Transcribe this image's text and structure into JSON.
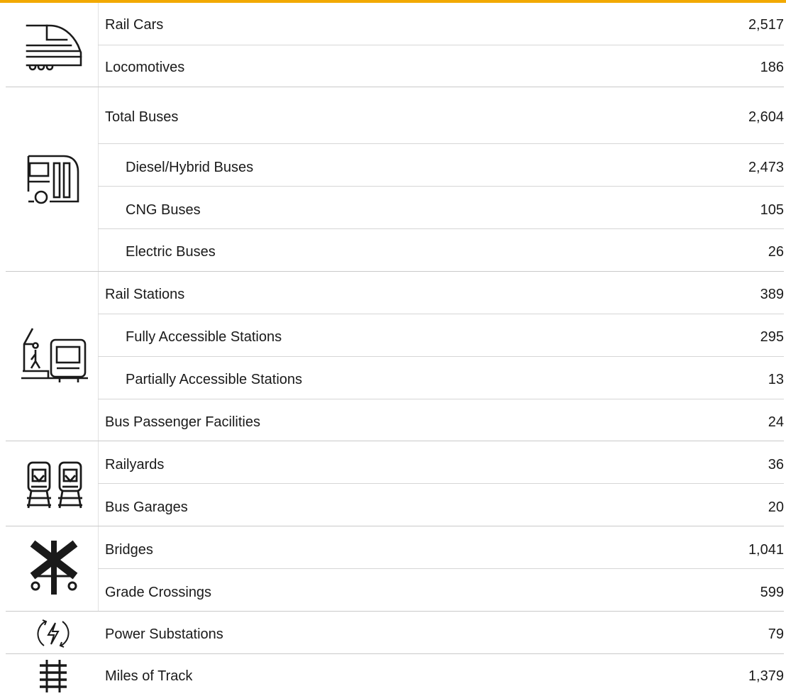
{
  "colors": {
    "accent_bar": "#f2a900",
    "divider": "#c9c9c9",
    "text": "#1a1a1a"
  },
  "groups": [
    {
      "icon": "train-front-icon",
      "rows": [
        {
          "label": "Rail Cars",
          "value": "2,517"
        },
        {
          "label": "Locomotives",
          "value": "186"
        }
      ]
    },
    {
      "icon": "bus-icon",
      "rows": [
        {
          "label": "Total Buses",
          "value": "2,604"
        },
        {
          "label": "Diesel/Hybrid Buses",
          "value": "2,473"
        },
        {
          "label": "CNG Buses",
          "value": "105"
        },
        {
          "label": "Electric Buses",
          "value": "26"
        }
      ]
    },
    {
      "icon": "accessible-station-icon",
      "rows": [
        {
          "label": "Rail Stations",
          "value": "389"
        },
        {
          "label": "Fully Accessible Stations",
          "value": "295"
        },
        {
          "label": "Partially Accessible Stations",
          "value": "13"
        },
        {
          "label": "Bus Passenger Facilities",
          "value": "24"
        }
      ]
    },
    {
      "icon": "railyard-trains-icon",
      "rows": [
        {
          "label": "Railyards",
          "value": "36"
        },
        {
          "label": "Bus Garages",
          "value": "20"
        }
      ]
    },
    {
      "icon": "railroad-crossing-icon",
      "rows": [
        {
          "label": "Bridges",
          "value": "1,041"
        },
        {
          "label": "Grade Crossings",
          "value": "599"
        }
      ]
    },
    {
      "icon": "power-substation-icon",
      "rows": [
        {
          "label": "Power Substations",
          "value": "79"
        }
      ]
    },
    {
      "icon": "track-icon",
      "rows": [
        {
          "label": "Miles of Track",
          "value": "1,379"
        }
      ]
    }
  ]
}
